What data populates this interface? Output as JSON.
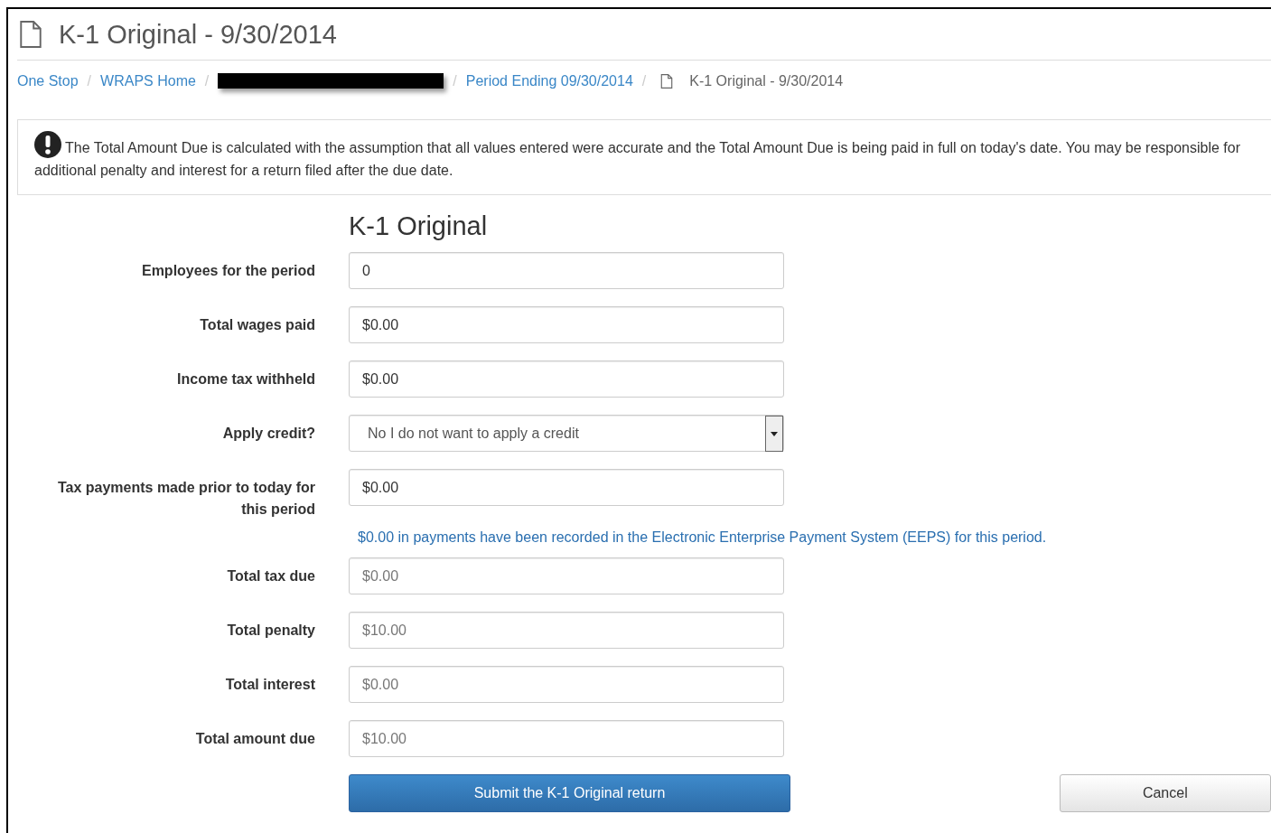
{
  "page_title": "K-1 Original - 9/30/2014",
  "breadcrumb_separator": "/",
  "breadcrumb": [
    {
      "kind": "link",
      "label": "One Stop"
    },
    {
      "kind": "link",
      "label": "WRAPS Home"
    },
    {
      "kind": "redacted"
    },
    {
      "kind": "link",
      "label": "Period Ending 09/30/2014"
    },
    {
      "kind": "current",
      "label": "K-1 Original - 9/30/2014"
    }
  ],
  "alert": {
    "text": "The Total Amount Due is calculated with the assumption that all values entered were accurate and the Total Amount Due is being paid in full on today's date. You may be responsible for additional penalty and interest for a return filed after the due date."
  },
  "form_title": "K-1 Original",
  "fields": [
    {
      "kind": "input",
      "label": "Employees for the period",
      "value": "0",
      "readonly": false
    },
    {
      "kind": "input",
      "label": "Total wages paid",
      "value": "$0.00",
      "readonly": false
    },
    {
      "kind": "input",
      "label": "Income tax withheld",
      "value": "$0.00",
      "readonly": false
    },
    {
      "kind": "select",
      "label": "Apply credit?",
      "value": "No I do not want to apply a credit"
    },
    {
      "kind": "input",
      "label": "Tax payments made prior to today for this period",
      "value": "$0.00",
      "readonly": false,
      "note": "$0.00 in payments have been recorded in the Electronic Enterprise Payment System (EEPS) for this period."
    },
    {
      "kind": "input",
      "label": "Total tax due",
      "value": "$0.00",
      "readonly": true
    },
    {
      "kind": "input",
      "label": "Total penalty",
      "value": "$10.00",
      "readonly": true
    },
    {
      "kind": "input",
      "label": "Total interest",
      "value": "$0.00",
      "readonly": true
    },
    {
      "kind": "input",
      "label": "Total amount due",
      "value": "$10.00",
      "readonly": true
    }
  ],
  "buttons": {
    "submit": "Submit the K-1 Original return",
    "cancel": "Cancel"
  }
}
